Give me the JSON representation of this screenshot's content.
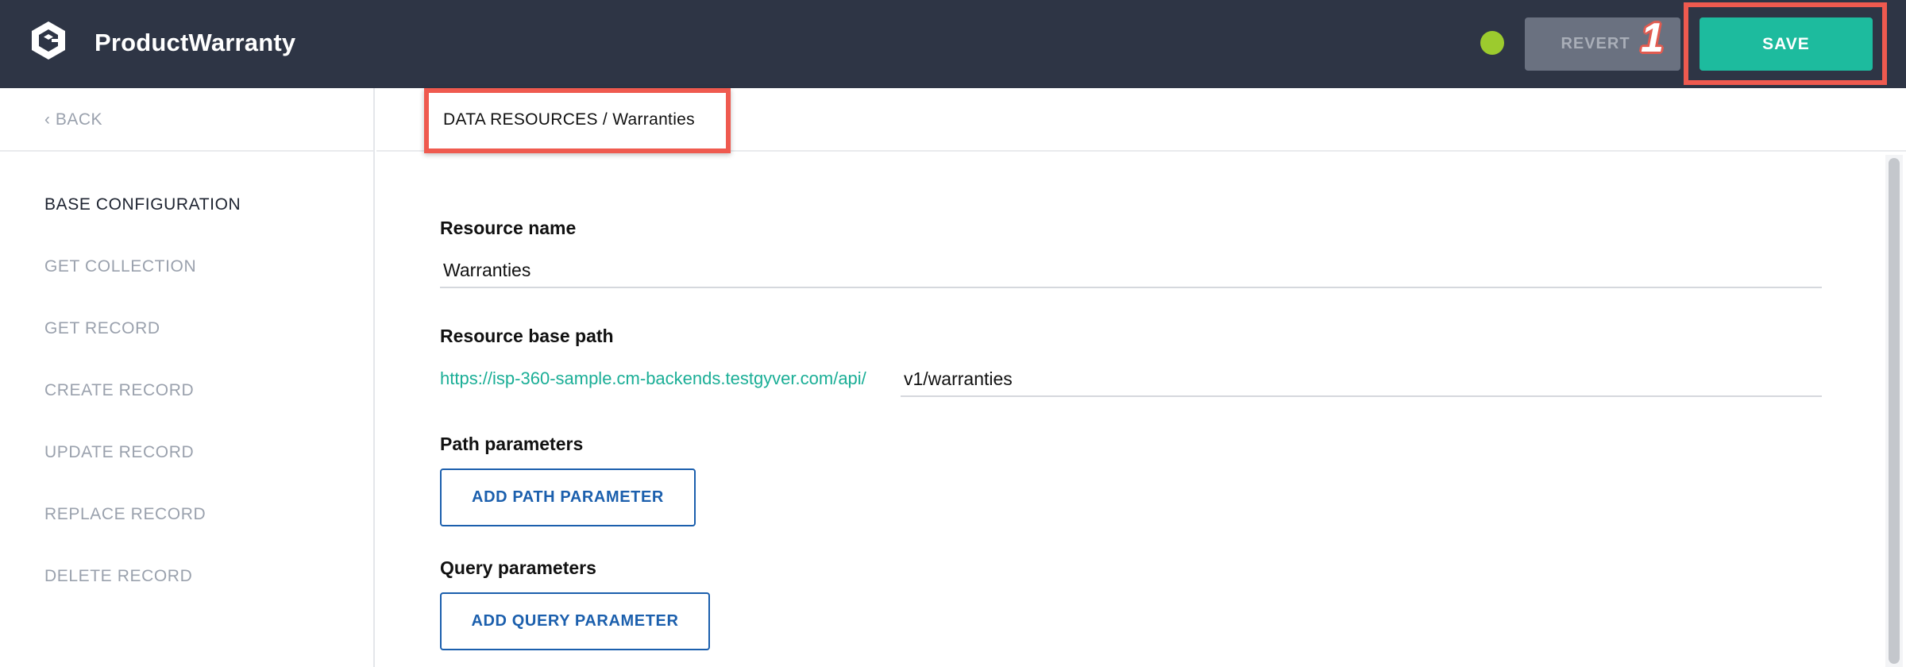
{
  "header": {
    "app_title": "ProductWarranty",
    "status_color": "#9ccb2e",
    "revert_label": "REVERT",
    "save_label": "SAVE",
    "callout_number": "1"
  },
  "sidebar": {
    "back_label": "‹ BACK",
    "items": [
      {
        "label": "BASE CONFIGURATION",
        "active": true
      },
      {
        "label": "GET COLLECTION",
        "active": false
      },
      {
        "label": "GET RECORD",
        "active": false
      },
      {
        "label": "CREATE RECORD",
        "active": false
      },
      {
        "label": "UPDATE RECORD",
        "active": false
      },
      {
        "label": "REPLACE RECORD",
        "active": false
      },
      {
        "label": "DELETE RECORD",
        "active": false
      }
    ]
  },
  "main": {
    "breadcrumb": "DATA RESOURCES / Warranties",
    "resource_name_label": "Resource name",
    "resource_name_value": "Warranties",
    "base_path_label": "Resource base path",
    "base_path_prefix": "https://isp-360-sample.cm-backends.testgyver.com/api/",
    "base_path_value": "v1/warranties",
    "path_params_label": "Path parameters",
    "add_path_param_label": "ADD PATH PARAMETER",
    "query_params_label": "Query parameters",
    "add_query_param_label": "ADD QUERY PARAMETER"
  },
  "colors": {
    "topbar": "#2e3545",
    "accent": "#1dbb9e",
    "link": "#1aae96",
    "button_outline": "#1b5fad",
    "highlight": "#ef5a4f"
  }
}
